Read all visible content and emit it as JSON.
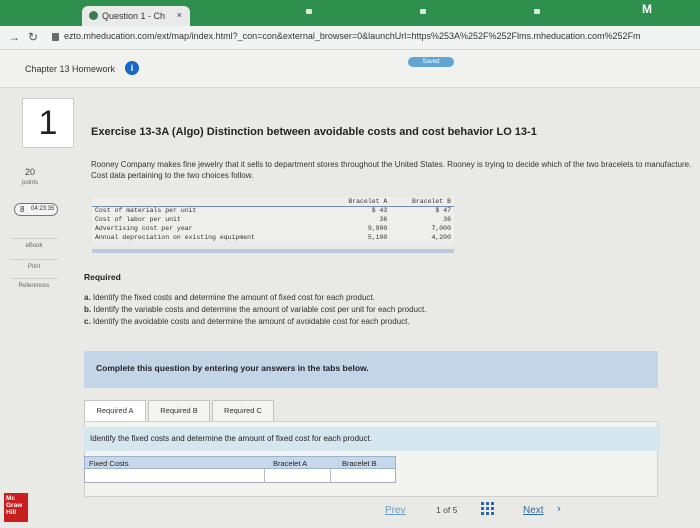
{
  "browser": {
    "tab_title": "Question 1 - Ch",
    "tab_close": "×",
    "url": "ezto.mheducation.com/ext/map/index.html?_con=con&external_browser=0&launchUrl=https%253A%252F%252Flms.mheducation.com%252Fm",
    "profile_letter": "M"
  },
  "header": {
    "homework_title": "Chapter 13 Homework",
    "info_icon": "i",
    "saved_label": "Saved"
  },
  "question": {
    "number": "1",
    "points_value": "20",
    "points_label": "points",
    "timer": "04:23:35",
    "timer_icon": "8"
  },
  "rail": {
    "ebook": "eBook",
    "print": "Print",
    "references": "References"
  },
  "exercise": {
    "title": "Exercise 13-3A (Algo) Distinction between avoidable costs and cost behavior LO 13-1",
    "intro": "Rooney Company makes fine jewelry that it sells to department stores throughout the United States. Rooney is trying to decide which of the two bracelets to manufacture. Cost data pertaining to the two choices follow."
  },
  "cost_table": {
    "col_a": "Bracelet A",
    "col_b": "Bracelet B",
    "rows": [
      {
        "label": "Cost of materials per unit",
        "a": "$    43",
        "b": "$    47"
      },
      {
        "label": "Cost of labor per unit",
        "a": "36",
        "b": "36"
      },
      {
        "label": "Advertising cost per year",
        "a": "9,900",
        "b": "7,000"
      },
      {
        "label": "Annual depreciation on existing equipment",
        "a": "5,100",
        "b": "4,200"
      }
    ]
  },
  "required": {
    "heading": "Required",
    "items": [
      {
        "letter": "a.",
        "text": "Identify the fixed costs and determine the amount of fixed cost for each product."
      },
      {
        "letter": "b.",
        "text": "Identify the variable costs and determine the amount of variable cost per unit for each product."
      },
      {
        "letter": "c.",
        "text": "Identify the avoidable costs and determine the amount of avoidable cost for each product."
      }
    ]
  },
  "complete_bar": "Complete this question by entering your answers in the tabs below.",
  "tabs": [
    "Required A",
    "Required B",
    "Required C"
  ],
  "instruction": "Identify the fixed costs and determine the amount of fixed cost for each product.",
  "answer_table": {
    "headers": [
      "Fixed Costs",
      "Bracelet A",
      "Bracelet B"
    ]
  },
  "logo": [
    "Mc",
    "Graw",
    "Hill"
  ],
  "footer": {
    "prev": "Prev",
    "page_current": "1",
    "page_of": "of",
    "page_total": "5",
    "next": "Next",
    "next_chevron": "›"
  }
}
